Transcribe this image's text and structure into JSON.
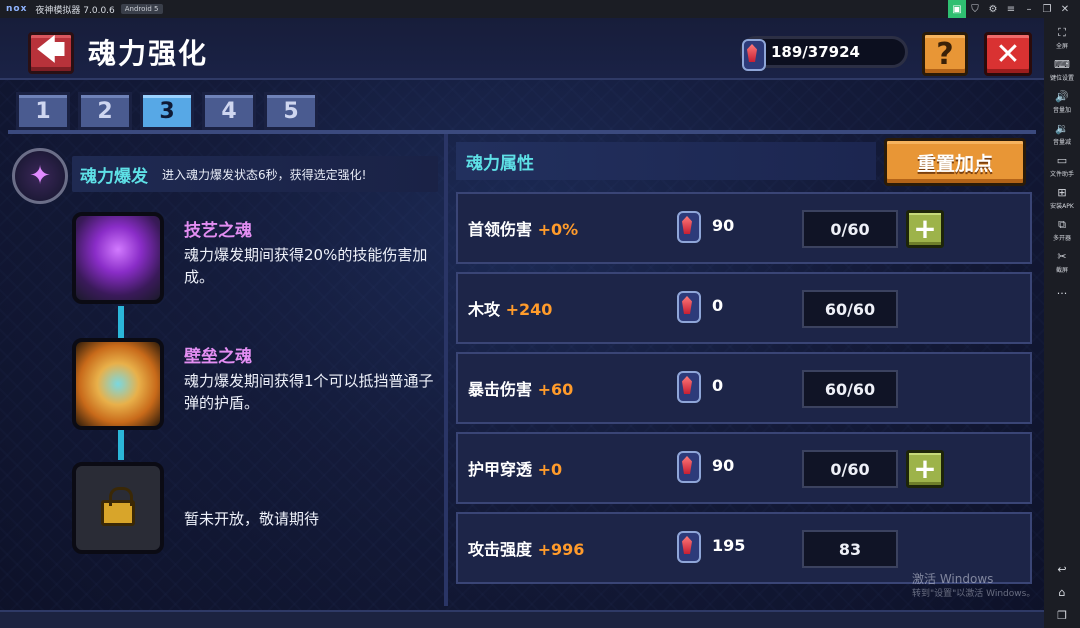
{
  "emulator": {
    "logo": "nox",
    "title": "夜神模拟器 7.0.0.6",
    "android_badge": "Android 5",
    "top_icons": [
      "app-icon",
      "tshirt-icon",
      "gear-icon",
      "menu-icon",
      "minimize-icon",
      "restore-icon",
      "close-icon"
    ],
    "sidebar": [
      {
        "icon": "fullscreen-icon",
        "label": "全屏"
      },
      {
        "icon": "keyboard-icon",
        "label": "键位设置"
      },
      {
        "icon": "volume-up-icon",
        "label": "音量加"
      },
      {
        "icon": "volume-down-icon",
        "label": "音量减"
      },
      {
        "icon": "file-icon",
        "label": "文件助手"
      },
      {
        "icon": "apk-icon",
        "label": "安装APK"
      },
      {
        "icon": "multi-icon",
        "label": "多开器"
      },
      {
        "icon": "scissors-icon",
        "label": "截屏"
      },
      {
        "icon": "more-icon",
        "label": "···"
      }
    ]
  },
  "header": {
    "back_glyph": "🡄",
    "title": "魂力强化",
    "currency": "189/37924",
    "help_glyph": "?",
    "close_glyph": "✕"
  },
  "tabs": [
    "1",
    "2",
    "3",
    "4",
    "5"
  ],
  "active_tab": "3",
  "left": {
    "burst_name": "魂力爆发",
    "burst_desc": "进入魂力爆发状态6秒，获得选定强化!",
    "souls": [
      {
        "name": "技艺之魂",
        "desc": "魂力爆发期间获得20%的技能伤害加成。"
      },
      {
        "name": "壁垒之魂",
        "desc": "魂力爆发期间获得1个可以抵挡普通子弹的护盾。"
      },
      {
        "name": "",
        "desc": "暂未开放，敬请期待"
      }
    ]
  },
  "right": {
    "title": "魂力属性",
    "reset_label": "重置加点",
    "attributes": [
      {
        "name": "首领伤害",
        "bonus": "+0%",
        "cost": "90",
        "count": "0/60",
        "plus": "+"
      },
      {
        "name": "木攻",
        "bonus": "+240",
        "cost": "0",
        "count": "60/60",
        "plus": ""
      },
      {
        "name": "暴击伤害",
        "bonus": "+60",
        "cost": "0",
        "count": "60/60",
        "plus": ""
      },
      {
        "name": "护甲穿透",
        "bonus": "+0",
        "cost": "90",
        "count": "0/60",
        "plus": "+"
      },
      {
        "name": "攻击强度",
        "bonus": "+996",
        "cost": "195",
        "count": "83",
        "plus": ""
      }
    ]
  },
  "watermark": {
    "line1": "激活 Windows",
    "line2": "转到\"设置\"以激活 Windows。"
  },
  "colors": {
    "accent_cyan": "#5ee0e6",
    "bonus_orange": "#ff9b2b",
    "soul_name_pink": "#e38ef2",
    "active_tab": "#57a8e6"
  }
}
